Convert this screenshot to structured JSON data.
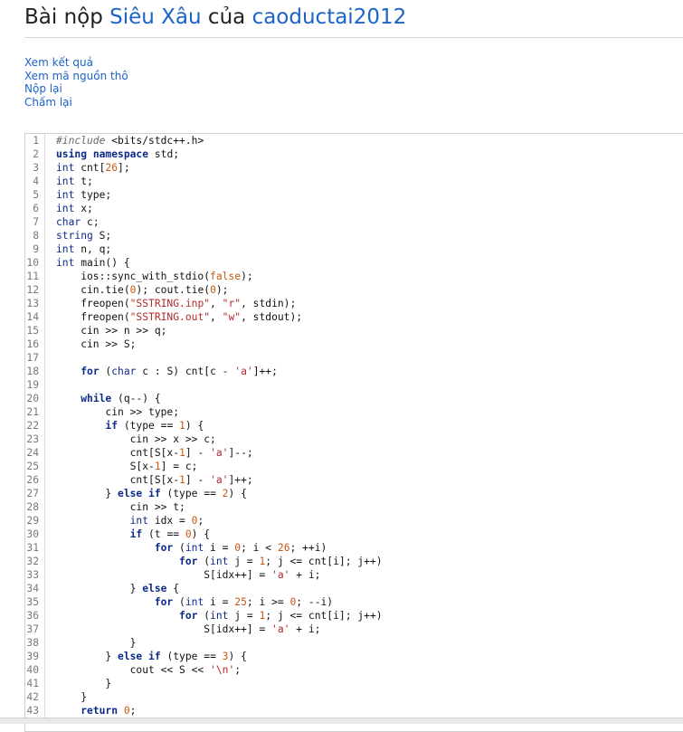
{
  "page": {
    "title_prefix": "Bài nộp",
    "problem": "Siêu Xâu",
    "title_mid": "của",
    "user": "caoductai2012"
  },
  "actions": [
    "Xem kết quả",
    "Xem mã nguồn thô",
    "Nộp lại",
    "Chấm lại"
  ],
  "code": [
    "#include <bits/stdc++.h>",
    "using namespace std;",
    "int cnt[26];",
    "int t;",
    "int type;",
    "int x;",
    "char c;",
    "string S;",
    "int n, q;",
    "int main() {",
    "    ios::sync_with_stdio(false);",
    "    cin.tie(0); cout.tie(0);",
    "    freopen(\"SSTRING.inp\", \"r\", stdin);",
    "    freopen(\"SSTRING.out\", \"w\", stdout);",
    "    cin >> n >> q;",
    "    cin >> S;",
    "",
    "    for (char c : S) cnt[c - 'a']++;",
    "",
    "    while (q--) {",
    "        cin >> type;",
    "        if (type == 1) {",
    "            cin >> x >> c;",
    "            cnt[S[x-1] - 'a']--;",
    "            S[x-1] = c;",
    "            cnt[S[x-1] - 'a']++;",
    "        } else if (type == 2) {",
    "            cin >> t;",
    "            int idx = 0;",
    "            if (t == 0) {",
    "                for (int i = 0; i < 26; ++i)",
    "                    for (int j = 1; j <= cnt[i]; j++)",
    "                        S[idx++] = 'a' + i;",
    "            } else {",
    "                for (int i = 25; i >= 0; --i)",
    "                    for (int j = 1; j <= cnt[i]; j++)",
    "                        S[idx++] = 'a' + i;",
    "            }",
    "        } else if (type == 3) {",
    "            cout << S << '\\n';",
    "        }",
    "    }",
    "    return 0;"
  ],
  "colors": {
    "link": "#1b63c8"
  }
}
